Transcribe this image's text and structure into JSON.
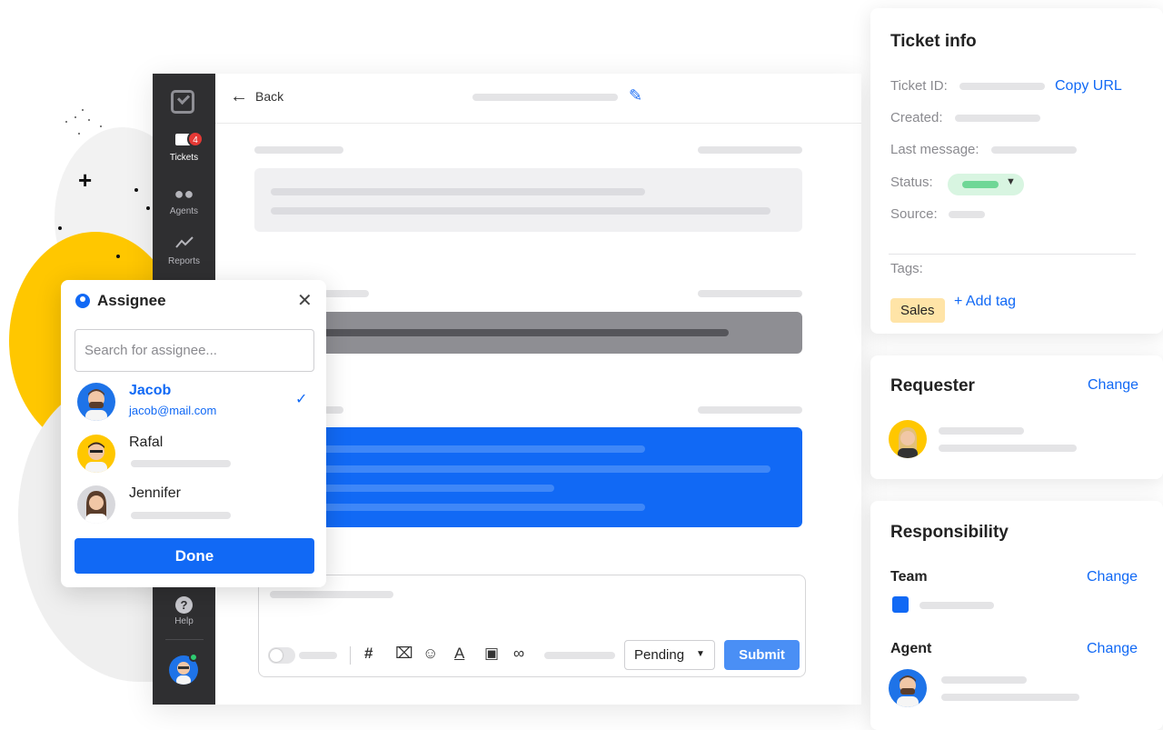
{
  "app": {
    "nav": [
      {
        "label": "Tickets",
        "icon": "ticket-icon",
        "badge": "4",
        "active": true
      },
      {
        "label": "Agents",
        "icon": "agents-icon"
      },
      {
        "label": "Reports",
        "icon": "reports-icon"
      },
      {
        "label": "Help",
        "icon": "help-icon"
      }
    ],
    "help_glyph": "?",
    "back_label": "Back",
    "composer": {
      "status_select": "Pending",
      "submit_label": "Submit",
      "tool_hash": "#"
    }
  },
  "assignee": {
    "title": "Assignee",
    "search_placeholder": "Search for assignee...",
    "people": [
      {
        "name": "Jacob",
        "email": "jacob@mail.com",
        "selected": true
      },
      {
        "name": "Rafal"
      },
      {
        "name": "Jennifer"
      }
    ],
    "done_label": "Done"
  },
  "ticket_info": {
    "title": "Ticket info",
    "id_label": "Ticket ID:",
    "copy_url": "Copy URL",
    "created_label": "Created:",
    "last_message_label": "Last message:",
    "status_label": "Status:",
    "source_label": "Source:",
    "tags_label": "Tags:",
    "tag": "Sales",
    "add_tag": "+ Add tag"
  },
  "requester": {
    "title": "Requester",
    "change": "Change"
  },
  "responsibility": {
    "title": "Responsibility",
    "team_label": "Team",
    "team_change": "Change",
    "agent_label": "Agent",
    "agent_change": "Change"
  },
  "colors": {
    "primary": "#1169f5",
    "sidebar": "#2f2f31",
    "accent_yellow": "#ffc700",
    "tag_bg": "#ffe4a7",
    "status_green": "#6fd796"
  }
}
